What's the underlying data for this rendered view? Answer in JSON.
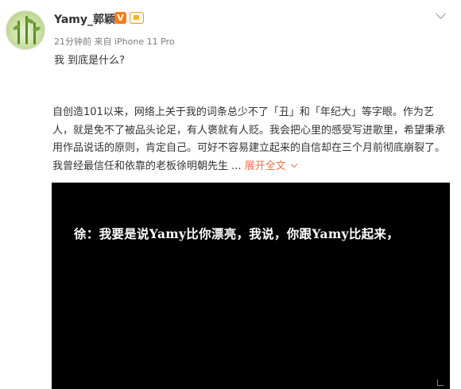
{
  "post": {
    "username": "Yamy_郭颖",
    "verified_badge": "V",
    "meta": "21分钟前 来自 iPhone 11 Pro",
    "status_text": "我 到底是什么?"
  },
  "quoted_post": {
    "text": "自创造101以来，网络上关于我的词条总少不了「丑」和「年纪大」等字眼。作为艺人，就是免不了被品头论足，有人褒就有人贬。我会把心里的感受写进歌里，希望秉承用作品说话的原则，肯定自己。可好不容易建立起来的自信却在三个月前彻底崩裂了。我曾经最信任和依靠的老板徐明朝先生 ...",
    "expand_label": "展开全文"
  },
  "video": {
    "subtitle": "徐：我要是说Yamy比你漂亮，我说，你跟Yamy比起来，"
  },
  "colors": {
    "accent": "#eb7350",
    "badge_orange": "#f37d1b",
    "video_bg": "#000000"
  },
  "icons": [
    "verified-v-icon",
    "level-badge-icon",
    "chevron-down-icon",
    "fullscreen-icon"
  ]
}
